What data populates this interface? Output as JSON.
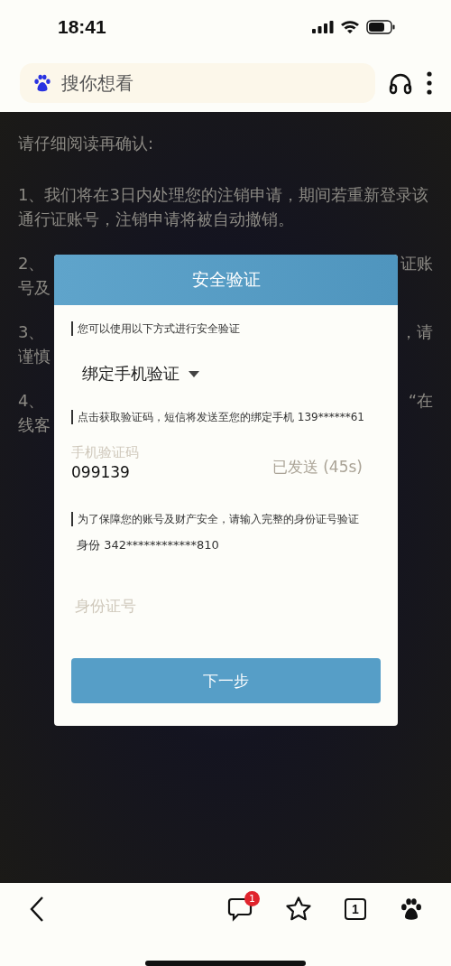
{
  "status_bar": {
    "time": "18:41"
  },
  "search_bar": {
    "placeholder": "搜你想看"
  },
  "background": {
    "heading": "请仔细阅读再确认:",
    "paragraphs": [
      {
        "lines": [
          {
            "left": "1、我们将在3日内处理您的注销申请，期间若重新登录该"
          },
          {
            "left": "通行证账号，注销申请将被自动撤销。"
          }
        ]
      },
      {
        "lines": [
          {
            "left": "2、",
            "right": "证账"
          },
          {
            "left": "号及"
          }
        ]
      },
      {
        "lines": [
          {
            "left": "3、",
            "right": "，请"
          },
          {
            "left": "谨慎"
          }
        ]
      },
      {
        "lines": [
          {
            "left": "4、",
            "right": "“在"
          },
          {
            "left": "线客"
          }
        ]
      }
    ]
  },
  "dialog": {
    "title": "安全验证",
    "method_note": "您可以使用以下方式进行安全验证",
    "method": "绑定手机验证",
    "sms_note": "点击获取验证码，短信将发送至您的绑定手机 139******61",
    "code_label": "手机验证码",
    "code_value": "099139",
    "send_button": {
      "label": "已发送 (45s)",
      "disabled": true
    },
    "id_note": "为了保障您的账号及财产安全，请输入完整的身份证号验证",
    "id_hint": "身份 342************810",
    "id_field": {
      "placeholder": "身份证号"
    },
    "next_button": "下一步"
  },
  "bottom_bar": {
    "messages_badge": "1",
    "tab_count": "1"
  }
}
